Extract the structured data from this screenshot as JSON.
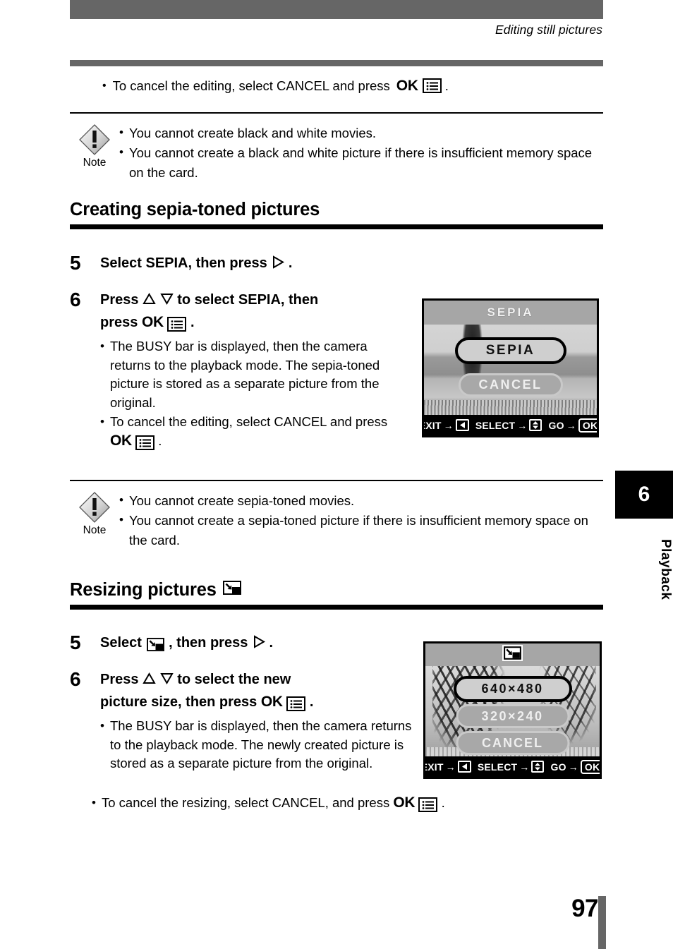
{
  "header": {
    "running_head": "Editing still pictures"
  },
  "intro_bullet": {
    "dot": "•",
    "text_before": "To cancel the editing, select CANCEL and press",
    "ok_label": "OK",
    "menu_icon": "menu-list-icon",
    "text_after": "."
  },
  "note_one": {
    "label": "Note",
    "icon": "warning-diamond-icon",
    "bullets": [
      "You cannot create black and white movies.",
      "You cannot create a black and white picture if there is insufficient memory space on the card."
    ]
  },
  "note_two": {
    "label": "Note",
    "icon": "warning-diamond-icon",
    "bullets": [
      "You cannot create sepia-toned movies.",
      "You cannot create a sepia-toned picture if there is insufficient memory space on the card."
    ]
  },
  "sepia_section": {
    "heading": "Creating sepia-toned pictures",
    "step5": {
      "number": "5",
      "text_before": "Select SEPIA, then press",
      "arrow_icon": "triangle-right-icon",
      "text_after": "."
    },
    "step6": {
      "number": "6",
      "line1_before": "Press",
      "up_icon": "triangle-up-icon",
      "down_icon": "triangle-down-icon",
      "line1_after": "to select SEPIA, then",
      "line2_before": "press",
      "ok_label": "OK",
      "menu_icon": "menu-list-icon",
      "line2_after": ".",
      "bullets": [
        "The BUSY bar is displayed, then the camera returns to the playback mode. The sepia-toned picture is stored as a separate picture from the original.",
        "To cancel the editing, select CANCEL and press"
      ],
      "bullet2_ok": "OK",
      "bullet2_after": "."
    },
    "lcd": {
      "title": "SEPIA",
      "options": [
        {
          "label": "SEPIA",
          "selected": true
        },
        {
          "label": "CANCEL",
          "selected": false
        }
      ],
      "guide": [
        {
          "label": "EXIT",
          "arrow": "→",
          "key": "◀",
          "key_icon": "left-arrow-key-icon"
        },
        {
          "label": "SELECT",
          "arrow": "→",
          "key": "▲▼",
          "key_icon": "up-down-key-icon"
        },
        {
          "label": "GO",
          "arrow": "→",
          "key": "OK",
          "key_icon": "ok-key-icon"
        }
      ]
    }
  },
  "resize_section": {
    "heading": "Resizing pictures",
    "heading_icon": "resize-picture-icon",
    "step5": {
      "number": "5",
      "text_before": "Select",
      "resize_icon": "resize-picture-icon",
      "text_mid": ", then press",
      "arrow_icon": "triangle-right-icon",
      "text_after": "."
    },
    "step6": {
      "number": "6",
      "line1_before": "Press",
      "up_icon": "triangle-up-icon",
      "down_icon": "triangle-down-icon",
      "line1_after": "to select the new",
      "line2_before": "picture size, then press",
      "ok_label": "OK",
      "menu_icon": "menu-list-icon",
      "line2_after": ".",
      "bullets": [
        "The BUSY bar is displayed, then the camera returns to the playback mode. The newly created picture is stored as a separate picture from the original.",
        "To cancel the resizing, select CANCEL, and press"
      ],
      "bullet2_ok": "OK",
      "bullet2_after": "."
    },
    "lcd": {
      "title_icon": "resize-picture-icon",
      "options": [
        {
          "label": "640×480",
          "selected": true
        },
        {
          "label": "320×240",
          "selected": false
        },
        {
          "label": "CANCEL",
          "selected": false
        }
      ],
      "guide": [
        {
          "label": "EXIT",
          "arrow": "→",
          "key": "◀",
          "key_icon": "left-arrow-key-icon"
        },
        {
          "label": "SELECT",
          "arrow": "→",
          "key": "▲▼",
          "key_icon": "up-down-key-icon"
        },
        {
          "label": "GO",
          "arrow": "→",
          "key": "OK",
          "key_icon": "ok-key-icon"
        }
      ]
    }
  },
  "chapter_tab": {
    "number": "6",
    "name": "Playback"
  },
  "footer": {
    "page_number": "97"
  },
  "colors": {
    "bar_gray": "#666666",
    "rule_black": "#000000",
    "lcd_header_gray": "#a6a6a6"
  }
}
